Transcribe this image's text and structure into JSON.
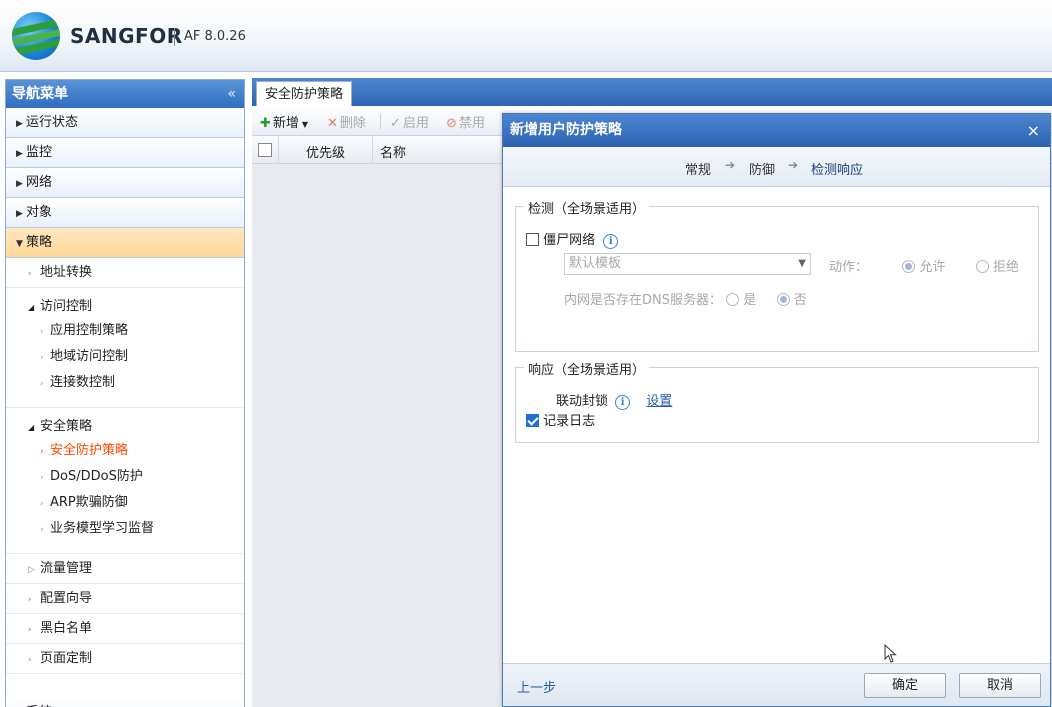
{
  "header": {
    "brand": "SANGFOR",
    "version": "AF 8.0.26"
  },
  "sidebar": {
    "title": "导航菜单",
    "collapse": "«",
    "categories": [
      "运行状态",
      "监控",
      "网络",
      "对象",
      "策略"
    ],
    "policy_sub": {
      "nat": "地址转换",
      "access_group": "访问控制",
      "access_items": [
        "应用控制策略",
        "地域访问控制",
        "连接数控制"
      ],
      "security_group": "安全策略",
      "security_items": [
        "安全防护策略",
        "DoS/DDoS防护",
        "ARP欺骗防御",
        "业务模型学习监督"
      ],
      "others": [
        "流量管理",
        "配置向导",
        "黑白名单",
        "页面定制"
      ]
    },
    "bottom_category": "系统"
  },
  "main": {
    "tab": "安全防护策略",
    "toolbar": {
      "add": "新增",
      "delete": "删除",
      "enable": "启用",
      "disable": "禁用"
    },
    "grid_columns": [
      "优先级",
      "名称"
    ]
  },
  "dialog": {
    "title": "新增用户防护策略",
    "close": "×",
    "steps": [
      "常规",
      "防御",
      "检测响应"
    ],
    "detect": {
      "legend": "检测（全场景适用）",
      "botnet_label": "僵尸网络",
      "botnet_checked": false,
      "template_value": "默认模板",
      "action_label": "动作：",
      "action_options": [
        "允许",
        "拒绝"
      ],
      "action_selected": "允许",
      "dns_label": "内网是否存在DNS服务器：",
      "dns_options": [
        "是",
        "否"
      ],
      "dns_selected": "否"
    },
    "response": {
      "legend": "响应（全场景适用）",
      "linkage_label": "联动封锁",
      "settings_link": "设置",
      "log_label": "记录日志",
      "log_checked": true
    },
    "footer": {
      "prev": "上一步",
      "ok": "确定",
      "cancel": "取消"
    }
  }
}
